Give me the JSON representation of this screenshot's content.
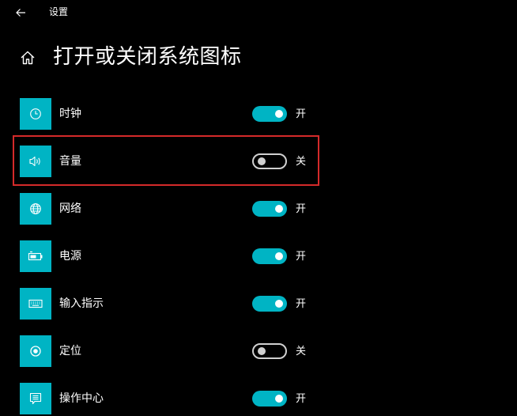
{
  "window": {
    "title": "设置"
  },
  "page": {
    "title": "打开或关闭系统图标"
  },
  "colors": {
    "accent": "#00b4c4",
    "background": "#000000",
    "highlight_border": "#d42a2a"
  },
  "items": [
    {
      "label": "时钟",
      "icon": "clock-icon",
      "on": true,
      "state": "开"
    },
    {
      "label": "音量",
      "icon": "volume-icon",
      "on": false,
      "state": "关"
    },
    {
      "label": "网络",
      "icon": "globe-icon",
      "on": true,
      "state": "开"
    },
    {
      "label": "电源",
      "icon": "battery-icon",
      "on": true,
      "state": "开"
    },
    {
      "label": "输入指示",
      "icon": "keyboard-icon",
      "on": true,
      "state": "开"
    },
    {
      "label": "定位",
      "icon": "location-icon",
      "on": false,
      "state": "关"
    },
    {
      "label": "操作中心",
      "icon": "action-center-icon",
      "on": true,
      "state": "开"
    }
  ]
}
